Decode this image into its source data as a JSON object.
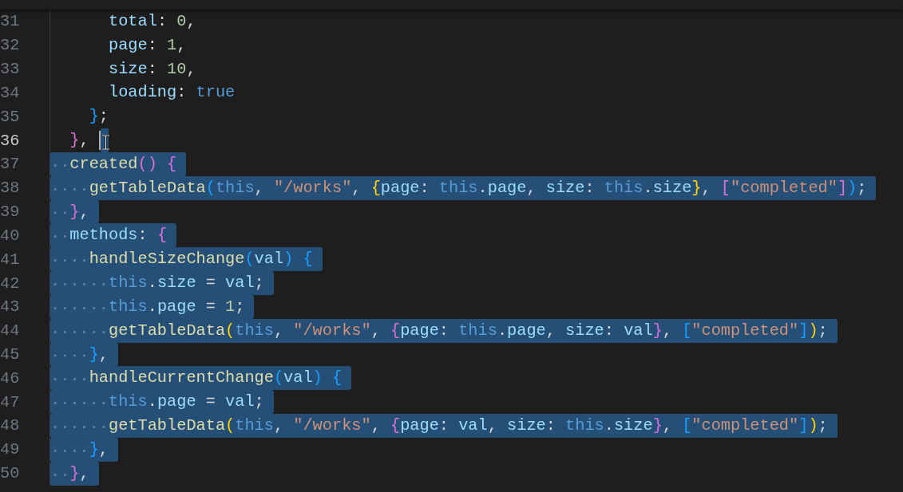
{
  "editor": {
    "lines": [
      {
        "children": [
          {
            "children": [
              {
                "number": "31",
                "selected": false,
                "cursor": false,
                "tokens": [
                  {
                    "text": "total",
                    "kind": "prop"
                  },
                  {
                    "text": ": ",
                    "kind": "punc"
                  },
                  {
                    "text": "0",
                    "kind": "num"
                  },
                  {
                    "text": ",",
                    "kind": "punc"
                  }
                ]
              },
              {
                "number": "32",
                "selected": false,
                "cursor": false,
                "tokens": [
                  {
                    "text": "page",
                    "kind": "prop"
                  },
                  {
                    "text": ": ",
                    "kind": "punc"
                  },
                  {
                    "text": "1",
                    "kind": "num"
                  },
                  {
                    "text": ",",
                    "kind": "punc"
                  }
                ]
              },
              {
                "number": "33",
                "selected": false,
                "cursor": false,
                "tokens": [
                  {
                    "text": "size",
                    "kind": "prop"
                  },
                  {
                    "text": ": ",
                    "kind": "punc"
                  },
                  {
                    "text": "10",
                    "kind": "num"
                  },
                  {
                    "text": ",",
                    "kind": "punc"
                  }
                ]
              },
              {
                "number": "34",
                "selected": false,
                "cursor": false,
                "tokens": [
                  {
                    "text": "loading",
                    "kind": "prop"
                  },
                  {
                    "text": ": ",
                    "kind": "punc"
                  },
                  {
                    "text": "true",
                    "kind": "kw"
                  }
                ]
              }
            ]
          },
          {
            "number": "35",
            "selected": false,
            "cursor": false,
            "tokens": [
              {
                "text": "}",
                "kind": "b3"
              },
              {
                "text": ";",
                "kind": "punc"
              }
            ]
          }
        ]
      },
      {
        "number": "36",
        "selected": false,
        "cursor": true,
        "tokens": [
          {
            "text": "}",
            "kind": "b2"
          },
          {
            "text": ",",
            "kind": "punc"
          }
        ]
      },
      {
        "number": "37",
        "selected": true,
        "cursor": false,
        "tokens": [
          {
            "text": "created",
            "kind": "fn"
          },
          {
            "text": "(",
            "kind": "b2"
          },
          {
            "text": ")",
            "kind": "b2"
          },
          {
            "text": " {",
            "kind": "b2"
          }
        ],
        "children": [
          {
            "number": "38",
            "selected": true,
            "cursor": false,
            "tokens": [
              {
                "text": "getTableData",
                "kind": "fn"
              },
              {
                "text": "(",
                "kind": "b3"
              },
              {
                "text": "this",
                "kind": "kw"
              },
              {
                "text": ", ",
                "kind": "punc"
              },
              {
                "text": "\"/works\"",
                "kind": "str"
              },
              {
                "text": ", ",
                "kind": "punc"
              },
              {
                "text": "{",
                "kind": "b1"
              },
              {
                "text": "page",
                "kind": "prop"
              },
              {
                "text": ": ",
                "kind": "punc"
              },
              {
                "text": "this",
                "kind": "kw"
              },
              {
                "text": ".",
                "kind": "punc"
              },
              {
                "text": "page",
                "kind": "prop"
              },
              {
                "text": ", ",
                "kind": "punc"
              },
              {
                "text": "size",
                "kind": "prop"
              },
              {
                "text": ": ",
                "kind": "punc"
              },
              {
                "text": "this",
                "kind": "kw"
              },
              {
                "text": ".",
                "kind": "punc"
              },
              {
                "text": "size",
                "kind": "prop"
              },
              {
                "text": "}",
                "kind": "b1"
              },
              {
                "text": ", ",
                "kind": "punc"
              },
              {
                "text": "[",
                "kind": "b2"
              },
              {
                "text": "\"completed\"",
                "kind": "str"
              },
              {
                "text": "]",
                "kind": "b2"
              },
              {
                "text": ")",
                "kind": "b3"
              },
              {
                "text": ";",
                "kind": "punc"
              }
            ]
          }
        ]
      },
      {
        "number": "39",
        "selected": true,
        "cursor": false,
        "tokens": [
          {
            "text": "}",
            "kind": "b2"
          },
          {
            "text": ",",
            "kind": "punc"
          }
        ]
      },
      {
        "number": "40",
        "selected": true,
        "cursor": false,
        "tokens": [
          {
            "text": "methods",
            "kind": "prop"
          },
          {
            "text": ": ",
            "kind": "punc"
          },
          {
            "text": "{",
            "kind": "b2"
          }
        ],
        "children": [
          {
            "number": "41",
            "selected": true,
            "cursor": false,
            "tokens": [
              {
                "text": "handleSizeChange",
                "kind": "fn"
              },
              {
                "text": "(",
                "kind": "b3"
              },
              {
                "text": "val",
                "kind": "prop"
              },
              {
                "text": ")",
                "kind": "b3"
              },
              {
                "text": " {",
                "kind": "b3"
              }
            ],
            "children": [
              {
                "number": "42",
                "selected": true,
                "cursor": false,
                "tokens": [
                  {
                    "text": "this",
                    "kind": "kw"
                  },
                  {
                    "text": ".",
                    "kind": "punc"
                  },
                  {
                    "text": "size",
                    "kind": "prop"
                  },
                  {
                    "text": " = ",
                    "kind": "punc"
                  },
                  {
                    "text": "val",
                    "kind": "prop"
                  },
                  {
                    "text": ";",
                    "kind": "punc"
                  }
                ]
              },
              {
                "number": "43",
                "selected": true,
                "cursor": false,
                "tokens": [
                  {
                    "text": "this",
                    "kind": "kw"
                  },
                  {
                    "text": ".",
                    "kind": "punc"
                  },
                  {
                    "text": "page",
                    "kind": "prop"
                  },
                  {
                    "text": " = ",
                    "kind": "punc"
                  },
                  {
                    "text": "1",
                    "kind": "num"
                  },
                  {
                    "text": ";",
                    "kind": "punc"
                  }
                ]
              },
              {
                "number": "44",
                "selected": true,
                "cursor": false,
                "tokens": [
                  {
                    "text": "getTableData",
                    "kind": "fn"
                  },
                  {
                    "text": "(",
                    "kind": "b1"
                  },
                  {
                    "text": "this",
                    "kind": "kw"
                  },
                  {
                    "text": ", ",
                    "kind": "punc"
                  },
                  {
                    "text": "\"/works\"",
                    "kind": "str"
                  },
                  {
                    "text": ", ",
                    "kind": "punc"
                  },
                  {
                    "text": "{",
                    "kind": "b2"
                  },
                  {
                    "text": "page",
                    "kind": "prop"
                  },
                  {
                    "text": ": ",
                    "kind": "punc"
                  },
                  {
                    "text": "this",
                    "kind": "kw"
                  },
                  {
                    "text": ".",
                    "kind": "punc"
                  },
                  {
                    "text": "page",
                    "kind": "prop"
                  },
                  {
                    "text": ", ",
                    "kind": "punc"
                  },
                  {
                    "text": "size",
                    "kind": "prop"
                  },
                  {
                    "text": ": ",
                    "kind": "punc"
                  },
                  {
                    "text": "val",
                    "kind": "prop"
                  },
                  {
                    "text": "}",
                    "kind": "b2"
                  },
                  {
                    "text": ", ",
                    "kind": "punc"
                  },
                  {
                    "text": "[",
                    "kind": "b3"
                  },
                  {
                    "text": "\"completed\"",
                    "kind": "str"
                  },
                  {
                    "text": "]",
                    "kind": "b3"
                  },
                  {
                    "text": ")",
                    "kind": "b1"
                  },
                  {
                    "text": ";",
                    "kind": "punc"
                  }
                ]
              }
            ]
          },
          {
            "number": "45",
            "selected": true,
            "cursor": false,
            "tokens": [
              {
                "text": "}",
                "kind": "b3"
              },
              {
                "text": ",",
                "kind": "punc"
              }
            ]
          },
          {
            "number": "46",
            "selected": true,
            "cursor": false,
            "tokens": [
              {
                "text": "handleCurrentChange",
                "kind": "fn"
              },
              {
                "text": "(",
                "kind": "b3"
              },
              {
                "text": "val",
                "kind": "prop"
              },
              {
                "text": ")",
                "kind": "b3"
              },
              {
                "text": " {",
                "kind": "b3"
              }
            ],
            "children": [
              {
                "number": "47",
                "selected": true,
                "cursor": false,
                "tokens": [
                  {
                    "text": "this",
                    "kind": "kw"
                  },
                  {
                    "text": ".",
                    "kind": "punc"
                  },
                  {
                    "text": "page",
                    "kind": "prop"
                  },
                  {
                    "text": " = ",
                    "kind": "punc"
                  },
                  {
                    "text": "val",
                    "kind": "prop"
                  },
                  {
                    "text": ";",
                    "kind": "punc"
                  }
                ]
              },
              {
                "number": "48",
                "selected": true,
                "cursor": false,
                "tokens": [
                  {
                    "text": "getTableData",
                    "kind": "fn"
                  },
                  {
                    "text": "(",
                    "kind": "b1"
                  },
                  {
                    "text": "this",
                    "kind": "kw"
                  },
                  {
                    "text": ", ",
                    "kind": "punc"
                  },
                  {
                    "text": "\"/works\"",
                    "kind": "str"
                  },
                  {
                    "text": ", ",
                    "kind": "punc"
                  },
                  {
                    "text": "{",
                    "kind": "b2"
                  },
                  {
                    "text": "page",
                    "kind": "prop"
                  },
                  {
                    "text": ": ",
                    "kind": "punc"
                  },
                  {
                    "text": "val",
                    "kind": "prop"
                  },
                  {
                    "text": ", ",
                    "kind": "punc"
                  },
                  {
                    "text": "size",
                    "kind": "prop"
                  },
                  {
                    "text": ": ",
                    "kind": "punc"
                  },
                  {
                    "text": "this",
                    "kind": "kw"
                  },
                  {
                    "text": ".",
                    "kind": "punc"
                  },
                  {
                    "text": "size",
                    "kind": "prop"
                  },
                  {
                    "text": "}",
                    "kind": "b2"
                  },
                  {
                    "text": ", ",
                    "kind": "punc"
                  },
                  {
                    "text": "[",
                    "kind": "b3"
                  },
                  {
                    "text": "\"completed\"",
                    "kind": "str"
                  },
                  {
                    "text": "]",
                    "kind": "b3"
                  },
                  {
                    "text": ")",
                    "kind": "b1"
                  },
                  {
                    "text": ";",
                    "kind": "punc"
                  }
                ]
              }
            ]
          },
          {
            "number": "49",
            "selected": true,
            "cursor": false,
            "tokens": [
              {
                "text": "}",
                "kind": "b3"
              },
              {
                "text": ",",
                "kind": "punc"
              }
            ]
          }
        ]
      },
      {
        "number": "50",
        "selected": true,
        "cursor": false,
        "tokens": [
          {
            "text": "}",
            "kind": "b2"
          },
          {
            "text": ",",
            "kind": "punc"
          }
        ]
      }
    ]
  }
}
